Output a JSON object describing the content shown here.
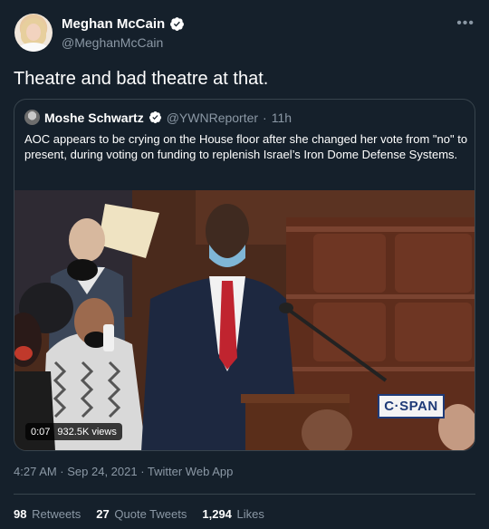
{
  "author": {
    "name": "Meghan McCain",
    "handle": "@MeghanMcCain",
    "verified": true
  },
  "tweet": {
    "text": "Theatre and bad theatre at that.",
    "timestamp": "4:27 AM · Sep 24, 2021 · Twitter Web App"
  },
  "quoted": {
    "name": "Moshe Schwartz",
    "handle": "@YWNReporter",
    "separator": "·",
    "time": "11h",
    "text": "AOC appears to be crying on the House floor after she changed her vote from \"no\" to present, during voting on funding to replenish Israel’s Iron Dome Defense Systems.",
    "video": {
      "duration": "0:07",
      "views": "932.5K views",
      "watermark": "C·SPAN"
    }
  },
  "stats": {
    "retweets_count": "98",
    "retweets_label": "Retweets",
    "quotes_count": "27",
    "quotes_label": "Quote Tweets",
    "likes_count": "1,294",
    "likes_label": "Likes"
  },
  "colors": {
    "background": "#15202b",
    "secondary_text": "#8b98a5",
    "border": "#38444d",
    "verified": "#1d9bf0"
  },
  "icons": {
    "verified": "verified-badge-icon",
    "more": "more-dots-icon"
  }
}
